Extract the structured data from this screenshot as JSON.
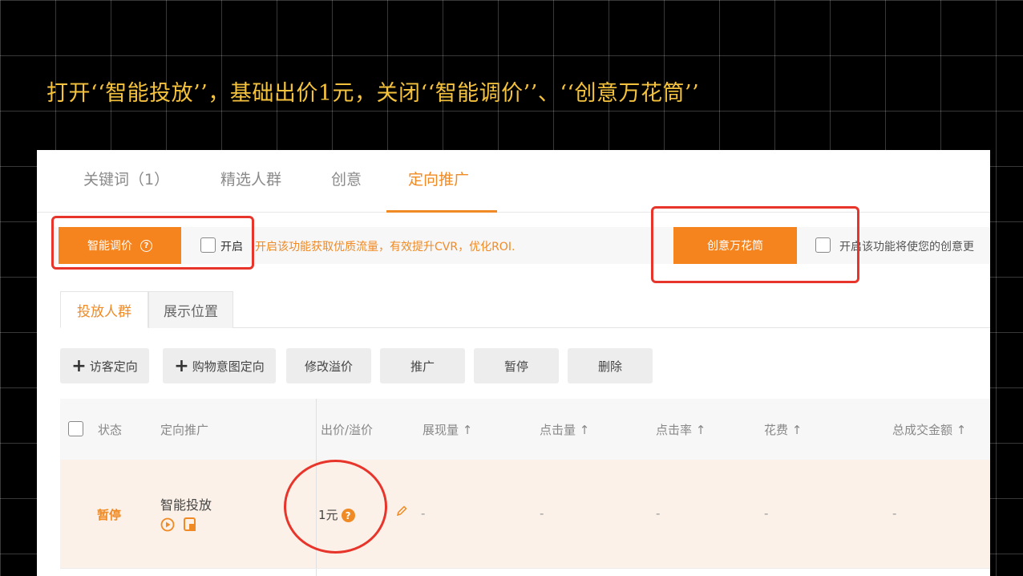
{
  "caption": "打开‘‘智能投放’’，基础出价1元，关闭‘‘智能调价’’、‘‘创意万花筒’’",
  "top_tabs": [
    "关键词（1）",
    "精选人群",
    "创意",
    "定向推广"
  ],
  "features": {
    "smart_price_label": "智能调价",
    "smart_price_help": "?",
    "enable_label": "开启",
    "smart_price_desc": "开启该功能获取优质流量，有效提升CVR，优化ROI.",
    "kaleido_label": "创意万花筒",
    "kaleido_desc": "开启该功能将使您的创意更"
  },
  "sub_tabs": [
    "投放人群",
    "展示位置"
  ],
  "actions": {
    "visitor": "访客定向",
    "purchase_intent": "购物意图定向",
    "modify_premium": "修改溢价",
    "promote": "推广",
    "pause": "暂停",
    "delete": "删除"
  },
  "table": {
    "headers": [
      "状态",
      "定向推广",
      "出价/溢价",
      "展现量 ↑",
      "点击量 ↑",
      "点击率 ↑",
      "花费 ↑",
      "总成交金额 ↑"
    ],
    "row": {
      "status": "暂停",
      "name": "智能投放",
      "bid": "1元",
      "bid_help": "?",
      "impressions": "-",
      "clicks": "-",
      "ctr": "-",
      "cost": "-",
      "gmv": "-"
    }
  },
  "colors": {
    "accent": "#f08a24",
    "highlight": "#e8352b",
    "caption": "#f4c23c"
  }
}
